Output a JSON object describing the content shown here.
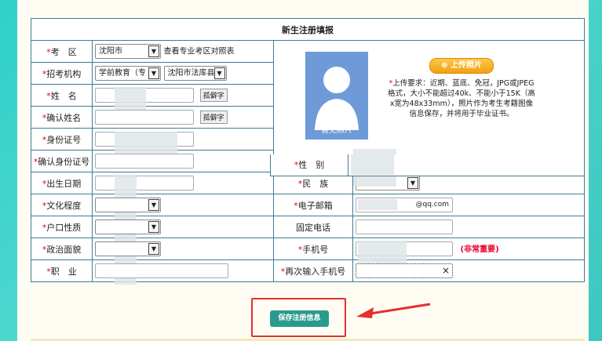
{
  "form": {
    "title": "新生注册填报",
    "required_mark": "*",
    "fields": {
      "exam_area": {
        "label": "考　区",
        "value": "沈阳市",
        "link": "查看专业考区对照表"
      },
      "institution": {
        "label": "招考机构",
        "value1": "学前教育（专",
        "value2": "沈阳市法库县"
      },
      "name": {
        "label": "姓　名",
        "helper": "孤僻字"
      },
      "confirm_name": {
        "label": "确认姓名",
        "helper": "孤僻字"
      },
      "id_number": {
        "label": "身份证号"
      },
      "confirm_id": {
        "label": "确认身份证号"
      },
      "birth_date": {
        "label": "出生日期"
      },
      "education": {
        "label": "文化程度"
      },
      "household": {
        "label": "户口性质"
      },
      "political": {
        "label": "政治面貌"
      },
      "occupation": {
        "label": "职　业"
      },
      "gender": {
        "label": "性　别"
      },
      "ethnicity": {
        "label": "民　族"
      },
      "email": {
        "label": "电子邮箱",
        "value": "@qq.com"
      },
      "landline": {
        "label": "固定电话"
      },
      "mobile": {
        "label": "手机号",
        "note": "(非常重要)"
      },
      "mobile_confirm": {
        "label": "再次输入手机号",
        "clear": "×"
      }
    },
    "photo": {
      "placeholder": "暂无照片",
      "upload_label": "上传照片",
      "requirements": "上传要求：近期、蓝底、免冠，JPG或JPEG格式，大小不能超过40k、不能小于15K（高x宽为48x33mm），照片作为考生考籍图像信息保存，并将用于毕业证书。"
    },
    "save_label": "保存注册信息"
  },
  "colors": {
    "border": "#3e7b93",
    "required": "#e4002b",
    "save": "#2b9a8e",
    "highlight": "#e3302d",
    "photo_bg": "#6e9bd8"
  }
}
